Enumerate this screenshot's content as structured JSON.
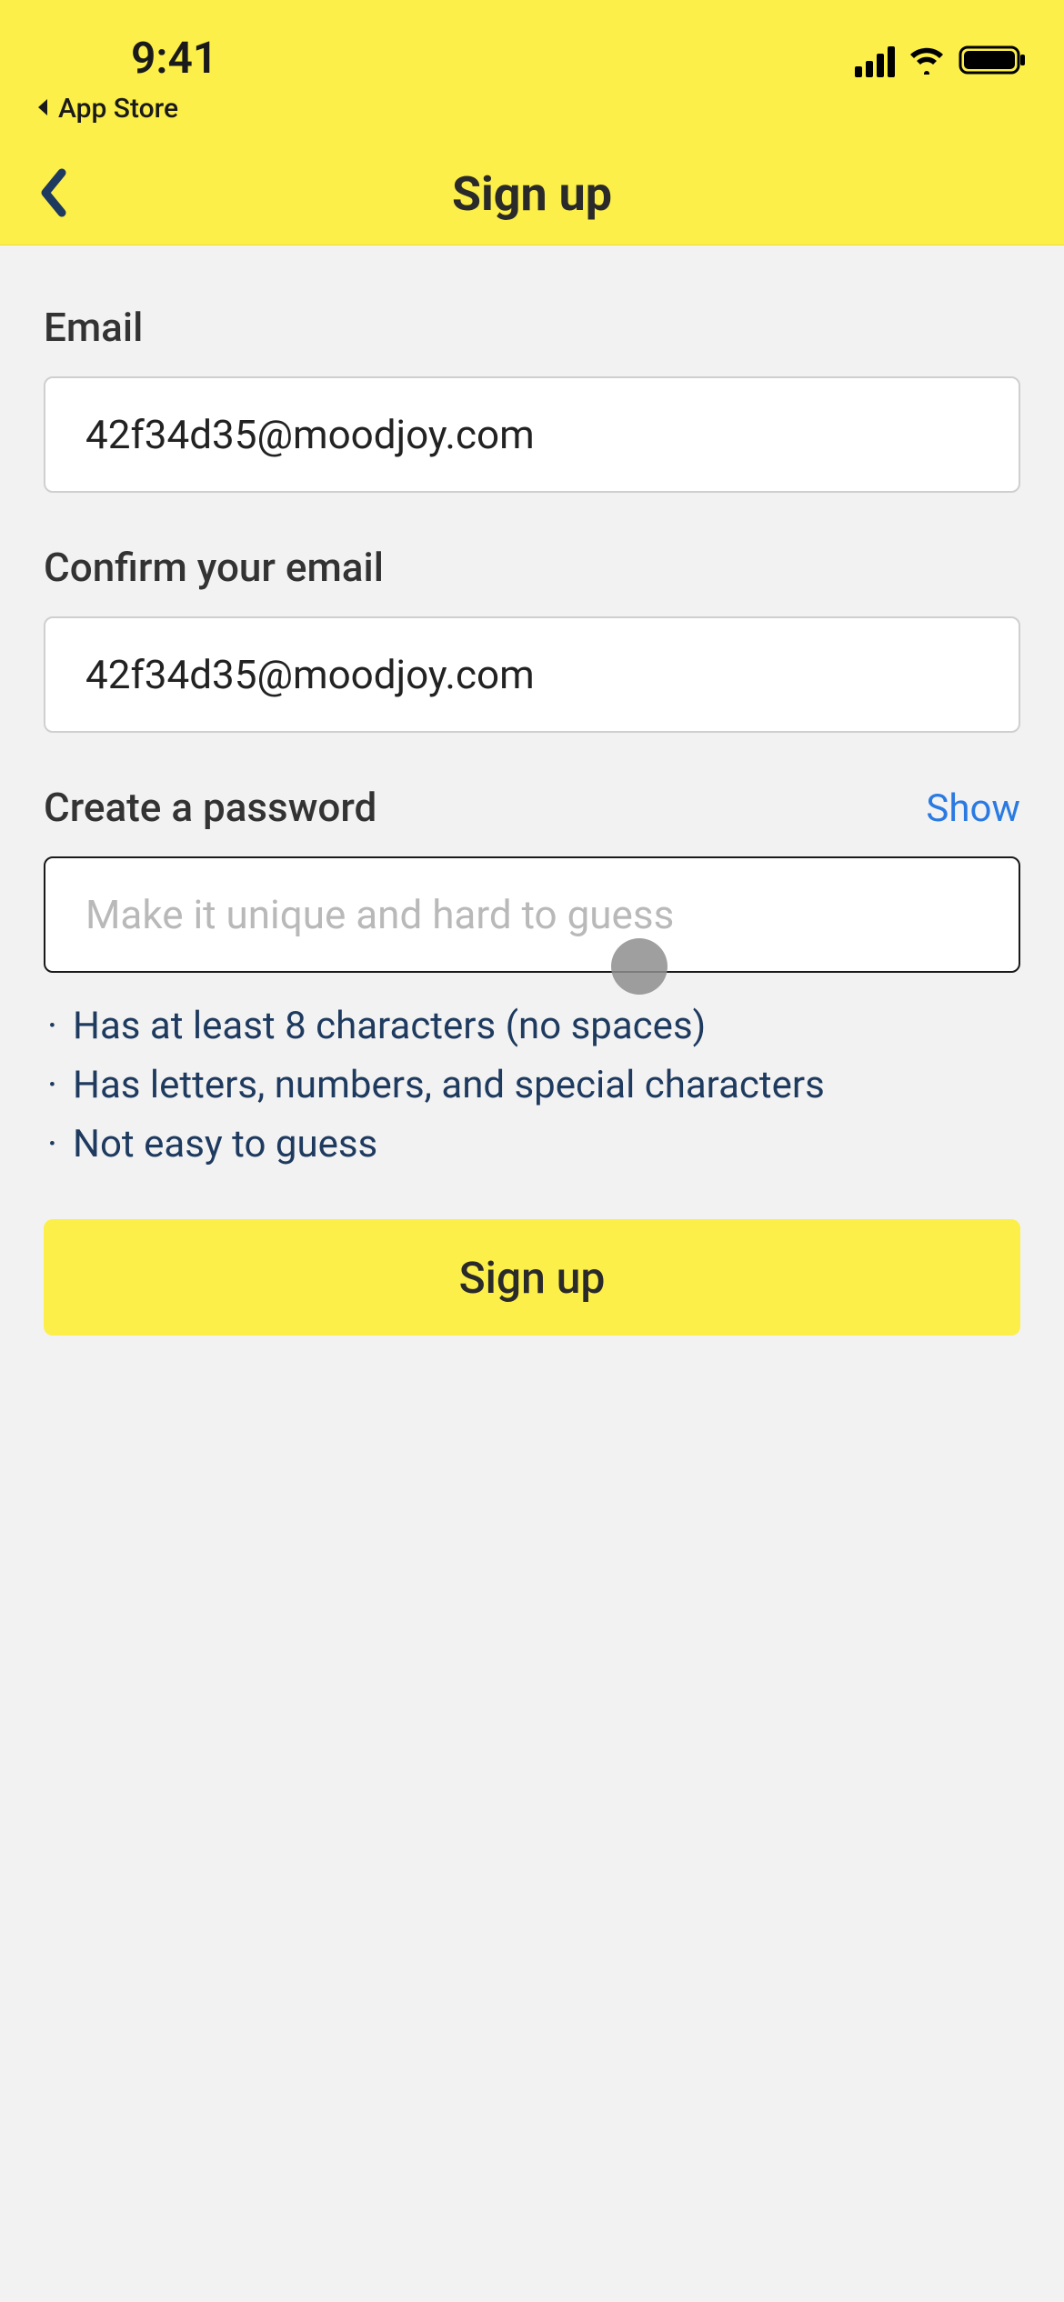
{
  "status": {
    "time": "9:41",
    "breadcrumb": "App Store"
  },
  "nav": {
    "title": "Sign up"
  },
  "form": {
    "email_label": "Email",
    "email_value": "42f34d35@moodjoy.com",
    "confirm_label": "Confirm your email",
    "confirm_value": "42f34d35@moodjoy.com",
    "password_label": "Create a password",
    "show_label": "Show",
    "password_placeholder": "Make it unique and hard to guess",
    "password_value": "",
    "requirements": [
      "Has at least 8 characters (no spaces)",
      "Has letters, numbers, and special characters",
      "Not easy to guess"
    ],
    "submit_label": "Sign up"
  }
}
